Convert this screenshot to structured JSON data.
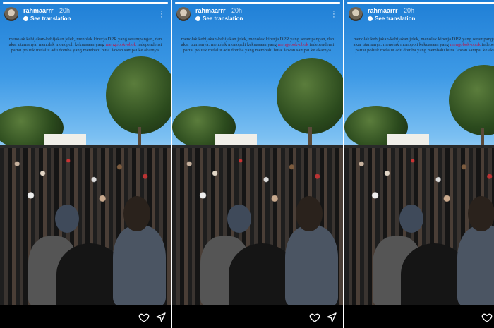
{
  "story": {
    "username": "rahmaarrr",
    "time": "20h",
    "see_translation": "See translation",
    "progress": 1,
    "caption_before": "menolak kebijakan-kebijakan jelek, menolak kinerja DPR yang serampangan, dan akar utamanya: menolak monopoli kekuasaan yang ",
    "caption_highlight": "mengobok-obok",
    "caption_after": " independensi partai politik melalui adu domba yang membabi buta. lawan sampai ke akarnya."
  },
  "icons": {
    "more": "more-vertical-icon",
    "like": "heart-icon",
    "share": "send-icon",
    "translate": "translate-icon"
  }
}
